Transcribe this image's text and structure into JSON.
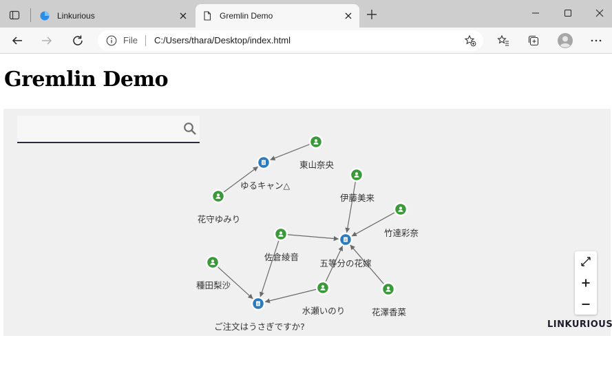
{
  "browser": {
    "tabs": [
      {
        "title": "Linkurious",
        "active": false
      },
      {
        "title": "Gremlin Demo",
        "active": true
      }
    ],
    "address": {
      "scheme": "File",
      "url": "C:/Users/thara/Desktop/index.html"
    },
    "accent": "#1a73e8"
  },
  "page": {
    "title": "Gremlin Demo",
    "search": {
      "value": "",
      "placeholder": ""
    },
    "brand": "LINKURIOUS"
  },
  "graph": {
    "colors": {
      "person": "#3a9a3a",
      "anime": "#2b7bbf",
      "edge": "#6a6a6a",
      "background": "#f0f0f0"
    },
    "nodes": [
      {
        "id": "yurucamp",
        "type": "anime",
        "label": "ゆるキャン△"
      },
      {
        "id": "gochiusa",
        "type": "anime",
        "label": "ご注文はうさぎですか?"
      },
      {
        "id": "gotoubun",
        "type": "anime",
        "label": "五等分の花嫁"
      },
      {
        "id": "toyama",
        "type": "person",
        "label": "東山奈央"
      },
      {
        "id": "hanamori",
        "type": "person",
        "label": "花守ゆみり"
      },
      {
        "id": "ito",
        "type": "person",
        "label": "伊藤美来"
      },
      {
        "id": "taketatsu",
        "type": "person",
        "label": "竹達彩奈"
      },
      {
        "id": "sakura",
        "type": "person",
        "label": "佐倉綾音"
      },
      {
        "id": "taneda",
        "type": "person",
        "label": "種田梨沙"
      },
      {
        "id": "minase",
        "type": "person",
        "label": "水瀬いのり"
      },
      {
        "id": "hanazawa",
        "type": "person",
        "label": "花澤香菜"
      }
    ],
    "edges": [
      {
        "from": "toyama",
        "to": "yurucamp"
      },
      {
        "from": "hanamori",
        "to": "yurucamp"
      },
      {
        "from": "ito",
        "to": "gotoubun"
      },
      {
        "from": "taketatsu",
        "to": "gotoubun"
      },
      {
        "from": "sakura",
        "to": "gotoubun"
      },
      {
        "from": "hanazawa",
        "to": "gotoubun"
      },
      {
        "from": "minase",
        "to": "gotoubun"
      },
      {
        "from": "sakura",
        "to": "gochiusa"
      },
      {
        "from": "taneda",
        "to": "gochiusa"
      },
      {
        "from": "minase",
        "to": "gochiusa"
      }
    ]
  }
}
